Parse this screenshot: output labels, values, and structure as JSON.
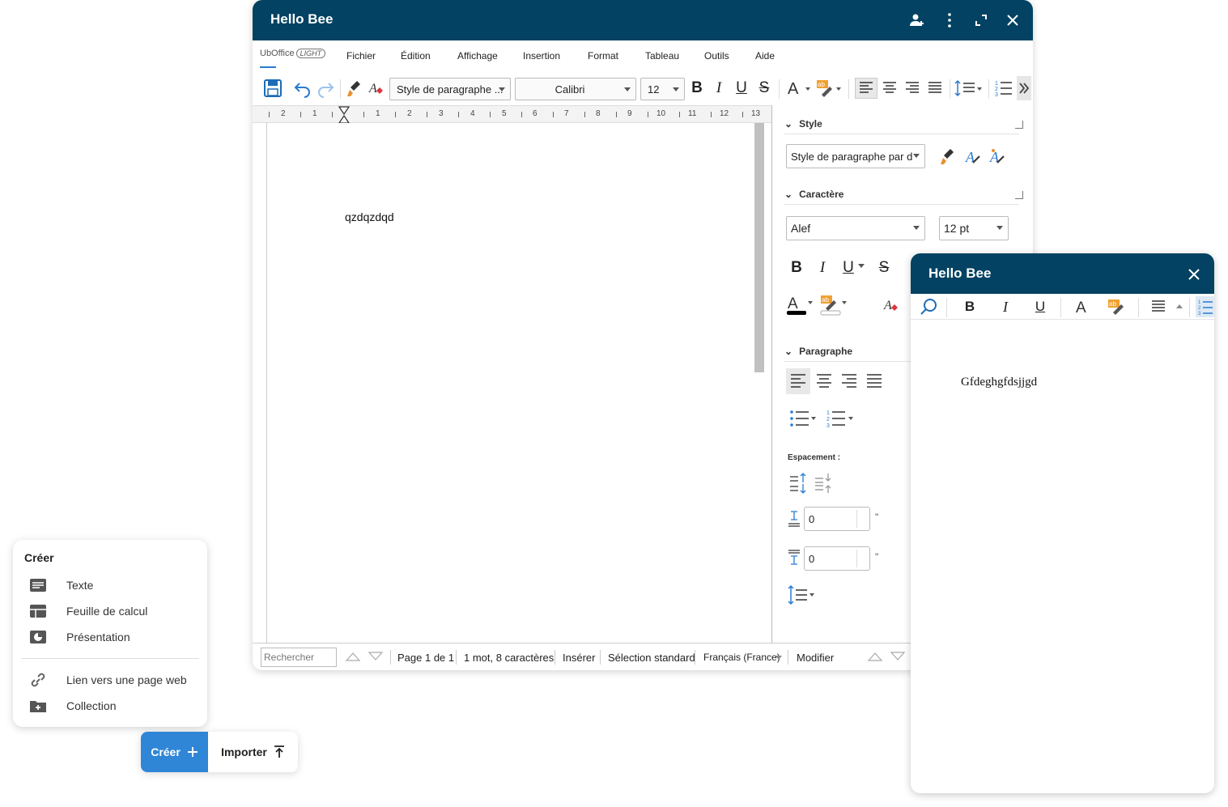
{
  "main_window": {
    "title": "Hello Bee",
    "logo": "UbOffice",
    "logo_badge": "LIGHT",
    "menu": [
      "Fichier",
      "Édition",
      "Affichage",
      "Insertion",
      "Format",
      "Tableau",
      "Outils",
      "Aide"
    ],
    "toolbar": {
      "paragraph_style": "Style de paragraphe ...",
      "font": "Calibri",
      "size": "12",
      "bold": "B",
      "italic": "I",
      "underline": "U",
      "strike": "S"
    },
    "ruler_labels": [
      "2",
      "1",
      "1",
      "1",
      "2",
      "3",
      "4",
      "5",
      "6",
      "7",
      "8",
      "9",
      "10",
      "11",
      "12",
      "13"
    ],
    "document_text": "qzdqzdqd",
    "side_panel": {
      "style_section": "Style",
      "style_value": "Style de paragraphe par d",
      "character_section": "Caractère",
      "font_value": "Alef",
      "size_value": "12 pt",
      "paragraph_section": "Paragraphe",
      "spacing_label": "Espacement :",
      "spacing_above": "0",
      "spacing_below": "0",
      "unit": "\""
    },
    "status": {
      "search_placeholder": "Rechercher",
      "page": "Page 1 de 1",
      "words": "1 mot, 8 caractères",
      "mode": "Insérer",
      "selection": "Sélection standard",
      "language": "Français (France)",
      "modify": "Modifier"
    }
  },
  "second_window": {
    "title": "Hello Bee",
    "document_text": "Gfdeghgfdsjjgd"
  },
  "create_menu": {
    "title": "Créer",
    "items": [
      {
        "label": "Texte",
        "icon": "text-document-icon"
      },
      {
        "label": "Feuille de calcul",
        "icon": "spreadsheet-icon"
      },
      {
        "label": "Présentation",
        "icon": "presentation-icon"
      },
      {
        "label": "Lien vers une page web",
        "icon": "link-icon"
      },
      {
        "label": "Collection",
        "icon": "add-folder-icon"
      }
    ]
  },
  "actions": {
    "create": "Créer",
    "import": "Importer"
  },
  "colors": {
    "titlebar": "#034262",
    "primary_button": "#2f86d6"
  }
}
